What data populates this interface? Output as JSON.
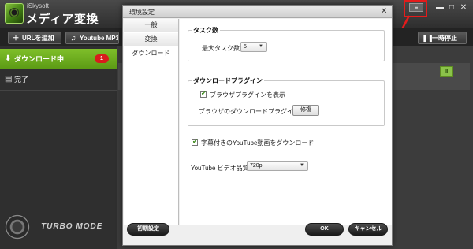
{
  "app": {
    "brand": "iSkysoft",
    "product": "メディア変換",
    "icons": {
      "menu": "menu-icon",
      "minimize": "minimize-icon",
      "maximize": "maximize-icon",
      "close": "close-icon"
    }
  },
  "toolbar": {
    "add_url": "URLを追加",
    "youtube_mp3": "Youtube MP3",
    "pause_all": "一時停止"
  },
  "sidebar": {
    "downloading": "ダウンロード中",
    "downloading_count": "1",
    "completed": "完了",
    "turbo_mode": "TURBO MODE"
  },
  "dialog": {
    "title": "環境設定",
    "tabs": [
      {
        "label": "一般"
      },
      {
        "label": "変換"
      },
      {
        "label": "ダウンロード"
      }
    ],
    "active_tab": "ダウンロード",
    "task_group": {
      "legend": "タスク数",
      "max_tasks_label": "最大タスク数:",
      "max_tasks_value": "5"
    },
    "plugin_group": {
      "legend": "ダウンロードプラグイン",
      "show_plugin_label": "ブラウザプラグインを表示",
      "show_plugin_checked": true,
      "browser_plugin_label": "ブラウザのダウンロードプラグイン:",
      "repair_button": "修復"
    },
    "subtitle_label": "字幕付きのYouTube動画をダウンロード",
    "subtitle_checked": true,
    "quality_label": "YouTube ビデオ品質:",
    "quality_value": "720p",
    "buttons": {
      "reset": "初期設定",
      "ok": "OK",
      "cancel": "キャンセル"
    }
  },
  "colors": {
    "accent_green": "#6aab1e",
    "badge_red": "#d81c1c",
    "highlight_red": "#e41b1b"
  }
}
